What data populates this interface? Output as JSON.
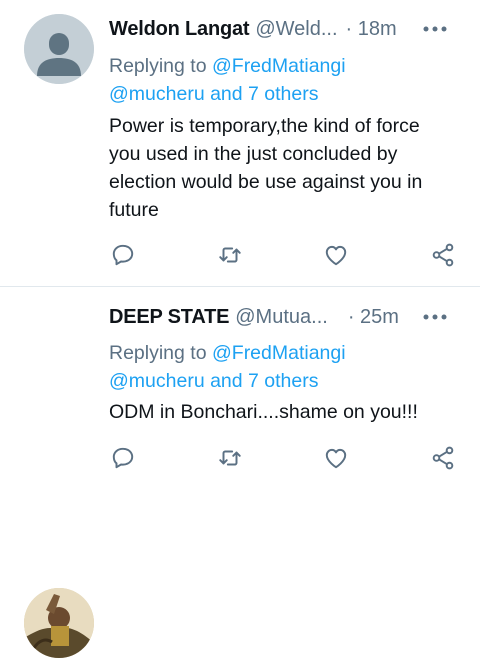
{
  "tweets": [
    {
      "name": "Weldon Langat",
      "handle": "@Weld...",
      "time": "· 18m",
      "replying_prefix": "Replying to ",
      "replying_mention": "@FredMatiangi",
      "replying_line2": "@mucheru and 7 others",
      "text": "Power is temporary,the kind of force you used in the just concluded by election would be use against you in future"
    },
    {
      "name": "DEEP STATE",
      "handle": "@Mutua...",
      "time": "· 25m",
      "replying_prefix": "Replying to ",
      "replying_mention": "@FredMatiangi",
      "replying_line2": "@mucheru and 7 others",
      "text": "ODM in Bonchari....shame on you!!!"
    }
  ],
  "icons": {
    "avatar_default": "default-avatar-icon",
    "more": "more-dots-icon",
    "reply": "reply-bubble-icon",
    "retweet": "retweet-icon",
    "like": "heart-icon",
    "share": "share-icon"
  },
  "colors": {
    "link": "#1da1f2",
    "secondary_text": "#5b7083",
    "primary_text": "#0f1419",
    "divider": "#e1e8ed"
  }
}
